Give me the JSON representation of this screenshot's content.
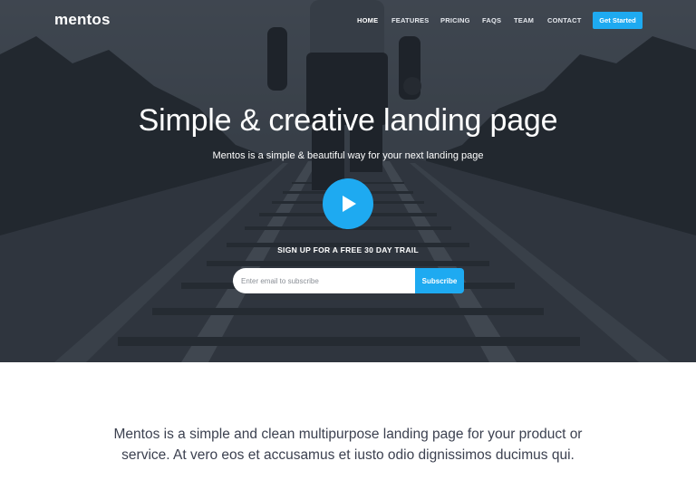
{
  "brand": {
    "logo": "mentos"
  },
  "nav": {
    "items": [
      "HOME",
      "FEATURES",
      "PRICING",
      "FAQS",
      "TEAM",
      "CONTACT"
    ],
    "active": "HOME",
    "cta_label": "Get Started"
  },
  "hero": {
    "title": "Simple & creative landing page",
    "subtitle": "Mentos is a simple & beautiful way for your next landing page",
    "signup_heading": "SIGN UP FOR A FREE 30 DAY TRAIL",
    "email_placeholder": "Enter email to subscribe",
    "subscribe_label": "Subscribe"
  },
  "intro": {
    "line1": "Mentos is a simple and clean multipurpose landing page for your product or",
    "line2": "service. At vero eos et accusamus et iusto odio dignissimos ducimus qui."
  },
  "colors": {
    "accent": "#1eaaf1",
    "hero_overlay": "#2f353d",
    "body_text": "#3c4150"
  },
  "icons": {
    "play": "play-icon"
  }
}
